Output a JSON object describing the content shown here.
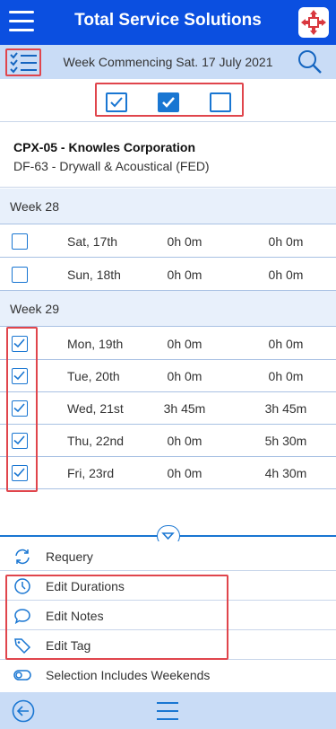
{
  "header": {
    "title": "Total Service Solutions"
  },
  "subbar": {
    "week_title": "Week Commencing Sat. 17 July 2021"
  },
  "job": {
    "code": "CPX-05 - Knowles Corporation",
    "subtitle": "DF-63 - Drywall & Acoustical (FED)"
  },
  "weeks": [
    {
      "label": "Week 28",
      "rows": [
        {
          "day": "Sat, 17th",
          "duration": "0h 0m",
          "total": "0h 0m",
          "checked": false
        },
        {
          "day": "Sun, 18th",
          "duration": "0h 0m",
          "total": "0h 0m",
          "checked": false
        }
      ]
    },
    {
      "label": "Week 29",
      "rows": [
        {
          "day": "Mon, 19th",
          "duration": "0h 0m",
          "total": "0h 0m",
          "checked": true
        },
        {
          "day": "Tue, 20th",
          "duration": "0h 0m",
          "total": "0h 0m",
          "checked": true
        },
        {
          "day": "Wed, 21st",
          "duration": "3h 45m",
          "total": "3h 45m",
          "checked": true
        },
        {
          "day": "Thu, 22nd",
          "duration": "0h 0m",
          "total": "5h 30m",
          "checked": true
        },
        {
          "day": "Fri, 23rd",
          "duration": "0h 0m",
          "total": "4h 30m",
          "checked": true
        }
      ]
    }
  ],
  "actions": {
    "requery": "Requery",
    "edit_durations": "Edit Durations",
    "edit_notes": "Edit Notes",
    "edit_tag": "Edit Tag",
    "selection_weekends": "Selection Includes Weekends"
  },
  "colors": {
    "header": "#0b4fe0",
    "subbar": "#c9dcf6",
    "accent": "#1976d2",
    "highlight": "#e0454c"
  },
  "icons": {
    "menu": "hamburger-icon",
    "logo": "app-logo-icon",
    "list": "checklist-icon",
    "search": "search-icon",
    "requery": "refresh-icon",
    "durations": "clock-icon",
    "notes": "speech-bubble-icon",
    "tag": "tag-icon",
    "weekends": "toggle-icon",
    "back": "back-arrow-icon",
    "collapse": "chevron-down-icon"
  }
}
